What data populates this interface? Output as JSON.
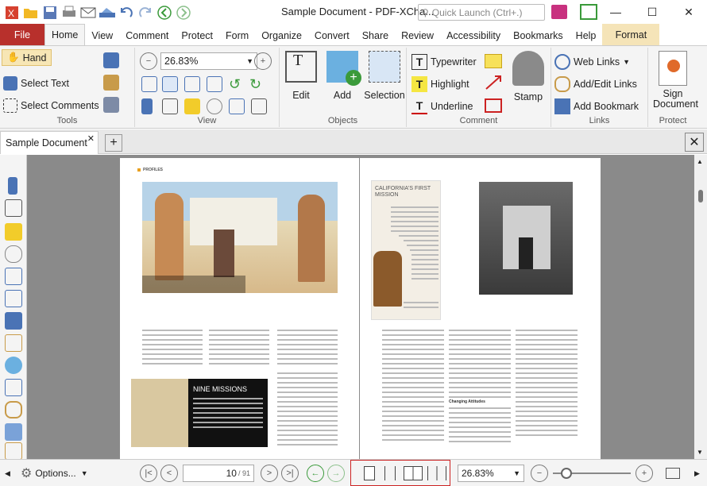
{
  "window": {
    "title": "Sample Document - PDF-XCha...",
    "search_placeholder": "Quick Launch (Ctrl+.)"
  },
  "tabs": [
    {
      "label": "File"
    },
    {
      "label": "Home"
    },
    {
      "label": "View"
    },
    {
      "label": "Comment"
    },
    {
      "label": "Protect"
    },
    {
      "label": "Form"
    },
    {
      "label": "Organize"
    },
    {
      "label": "Convert"
    },
    {
      "label": "Share"
    },
    {
      "label": "Review"
    },
    {
      "label": "Accessibility"
    },
    {
      "label": "Bookmarks"
    },
    {
      "label": "Help"
    },
    {
      "label": "Format"
    }
  ],
  "ribbon": {
    "tools": {
      "hand": "Hand",
      "select_text": "Select Text",
      "select_comments": "Select Comments",
      "label": "Tools"
    },
    "view": {
      "zoom": "26.83%",
      "label": "View"
    },
    "objects": {
      "edit": "Edit",
      "add": "Add",
      "selection": "Selection",
      "label": "Objects"
    },
    "comment": {
      "typewriter": "Typewriter",
      "highlight": "Highlight",
      "underline": "Underline",
      "stamp": "Stamp",
      "label": "Comment"
    },
    "links": {
      "web_links": "Web Links",
      "add_edit_links": "Add/Edit Links",
      "add_bookmark": "Add Bookmark",
      "label": "Links"
    },
    "protect": {
      "sign_document": "Sign Document",
      "label": "Protect"
    }
  },
  "doc_tab": {
    "label": "Sample Document"
  },
  "document": {
    "left_page": {
      "section": "PROFILES",
      "inset_title": "NINE MISSIONS"
    },
    "right_page": {
      "heading": "CALIFORNIA'S FIRST MISSION",
      "subhead": "Changing Attitudes"
    }
  },
  "statusbar": {
    "options": "Options...",
    "page_current": "10",
    "page_total": "/ 91",
    "zoom": "26.83%"
  }
}
